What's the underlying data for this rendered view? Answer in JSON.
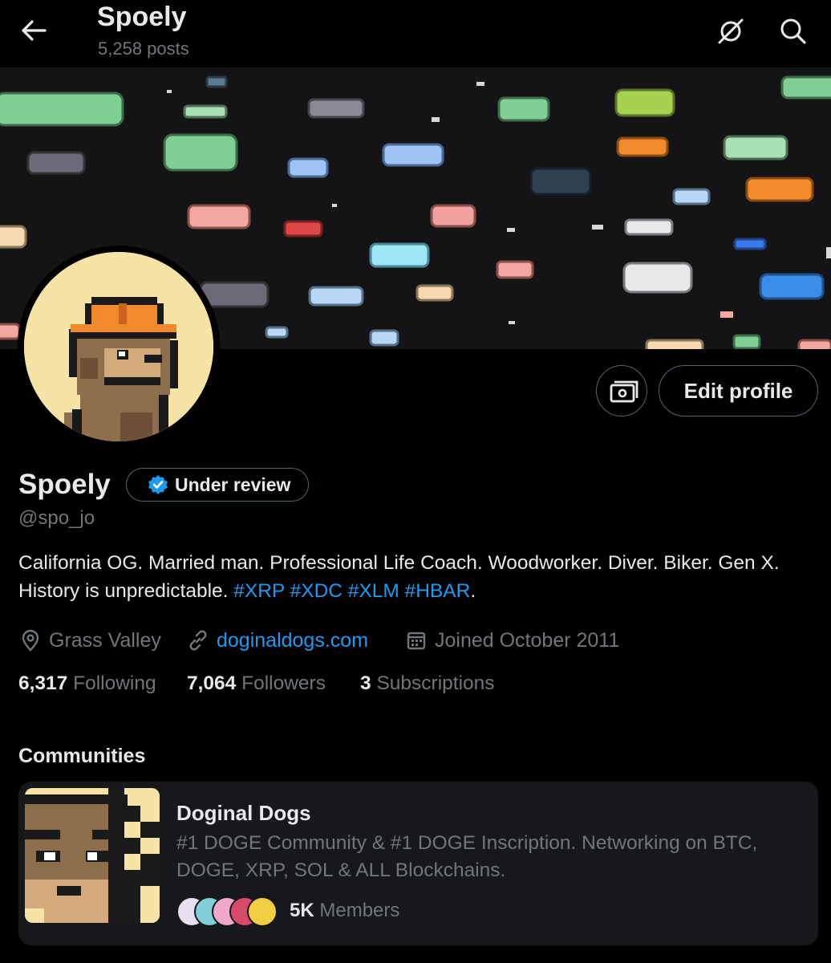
{
  "header": {
    "title": "Spoely",
    "posts": "5,258 posts"
  },
  "profile": {
    "display_name": "Spoely",
    "badge_label": "Under review",
    "handle": "@spo_jo",
    "edit_button": "Edit profile",
    "bio_text": "California OG. Married man. Professional Life Coach. Woodworker. Diver. Biker. Gen X. History is unpredictable.",
    "bio_hashtags": [
      "#XRP",
      "#XDC",
      "#XLM",
      "#HBAR"
    ],
    "bio_end": ".",
    "location": "Grass Valley",
    "website": "doginaldogs.com",
    "joined": "Joined October 2011"
  },
  "stats": {
    "following_count": "6,317",
    "following_label": "Following",
    "followers_count": "7,064",
    "followers_label": "Followers",
    "subs_count": "3",
    "subs_label": "Subscriptions"
  },
  "communities": {
    "heading": "Communities",
    "name": "Doginal Dogs",
    "description": "#1 DOGE Community & #1 DOGE Inscription. Networking on BTC, DOGE, XRP, SOL & ALL Blockchains.",
    "member_count": "5K",
    "member_label": "Members"
  },
  "colors": {
    "accent": "#1d9bf0",
    "background": "#000000",
    "muted": "#71767b",
    "avatar_bg": "#f6e3a5"
  },
  "icons": [
    "arrow-left-icon",
    "hide-icon",
    "search-icon",
    "location-icon",
    "link-icon",
    "calendar-icon",
    "verified-icon",
    "money-icon"
  ]
}
